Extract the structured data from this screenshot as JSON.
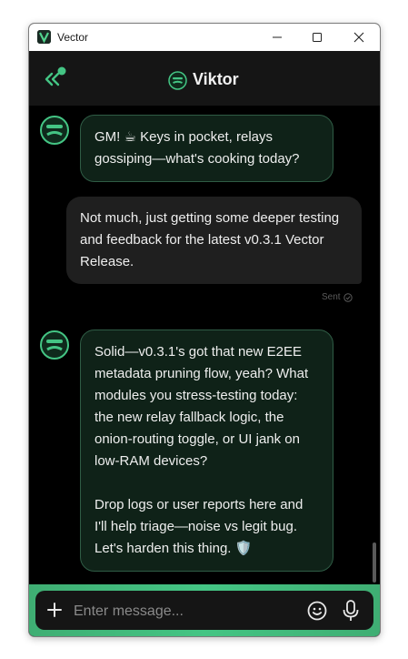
{
  "window": {
    "title": "Vector",
    "controls": [
      "minimize",
      "maximize",
      "close"
    ]
  },
  "header": {
    "contact_name": "Viktor",
    "back_icon": "double-chevron-left-icon"
  },
  "messages": [
    {
      "direction": "incoming",
      "text": "GM! ☕ Keys in pocket, relays gossiping—what's cooking today?"
    },
    {
      "direction": "outgoing",
      "text": "Not much, just getting some deeper testing and feedback for the latest v0.3.1 Vector Release.",
      "status": "Sent"
    },
    {
      "direction": "incoming",
      "text": "Solid—v0.3.1's got that new E2EE metadata pruning flow, yeah? What modules you stress-testing today: the new relay fallback logic, the onion-routing toggle, or UI jank on low-RAM devices?\n\nDrop logs or user reports here and I'll help triage—noise vs legit bug. Let's harden this thing. 🛡️"
    }
  ],
  "composer": {
    "placeholder": "Enter message...",
    "value": ""
  },
  "colors": {
    "accent": "#44c584",
    "incoming_bubble": "#0f2218",
    "incoming_border": "#2f5c45",
    "outgoing_bubble": "#1f1f1f",
    "background": "#000000"
  }
}
